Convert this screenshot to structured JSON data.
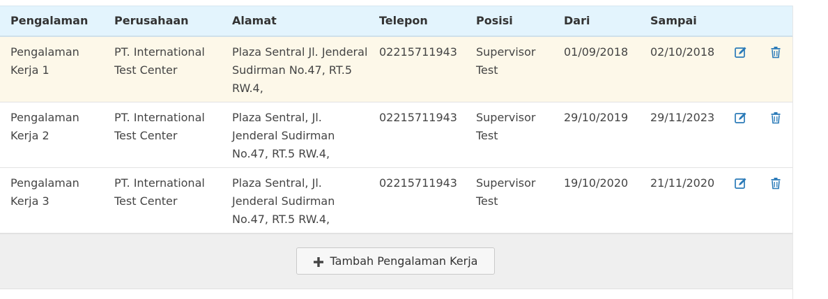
{
  "table": {
    "headers": {
      "pengalaman": "Pengalaman",
      "perusahaan": "Perusahaan",
      "alamat": "Alamat",
      "telepon": "Telepon",
      "posisi": "Posisi",
      "dari": "Dari",
      "sampai": "Sampai"
    },
    "rows": [
      {
        "pengalaman": "Pengalaman Kerja 1",
        "perusahaan": "PT. International Test Center",
        "alamat": "Plaza Sentral Jl. Jenderal Sudirman No.47, RT.5 RW.4,",
        "telepon": "02215711943",
        "posisi": "Supervisor Test",
        "dari": "01/09/2018",
        "sampai": "02/10/2018"
      },
      {
        "pengalaman": "Pengalaman Kerja 2",
        "perusahaan": "PT. International Test Center",
        "alamat": "Plaza Sentral, Jl. Jenderal Sudirman No.47, RT.5 RW.4,",
        "telepon": "02215711943",
        "posisi": "Supervisor Test",
        "dari": "29/10/2019",
        "sampai": "29/11/2023"
      },
      {
        "pengalaman": "Pengalaman Kerja 3",
        "perusahaan": "PT. International Test Center",
        "alamat": "Plaza Sentral, Jl. Jenderal Sudirman No.47, RT.5 RW.4,",
        "telepon": "02215711943",
        "posisi": "Supervisor Test",
        "dari": "19/10/2020",
        "sampai": "21/11/2020"
      }
    ]
  },
  "icons": {
    "edit": "edit-icon",
    "delete": "trash-icon",
    "add": "plus-icon"
  },
  "colors": {
    "header_bg": "#e3f4fd",
    "highlight_row": "#fdf8e9",
    "icon_blue": "#2a7ab8",
    "footer_bg": "#efefef"
  },
  "footer": {
    "add_label": "Tambah Pengalaman Kerja"
  }
}
